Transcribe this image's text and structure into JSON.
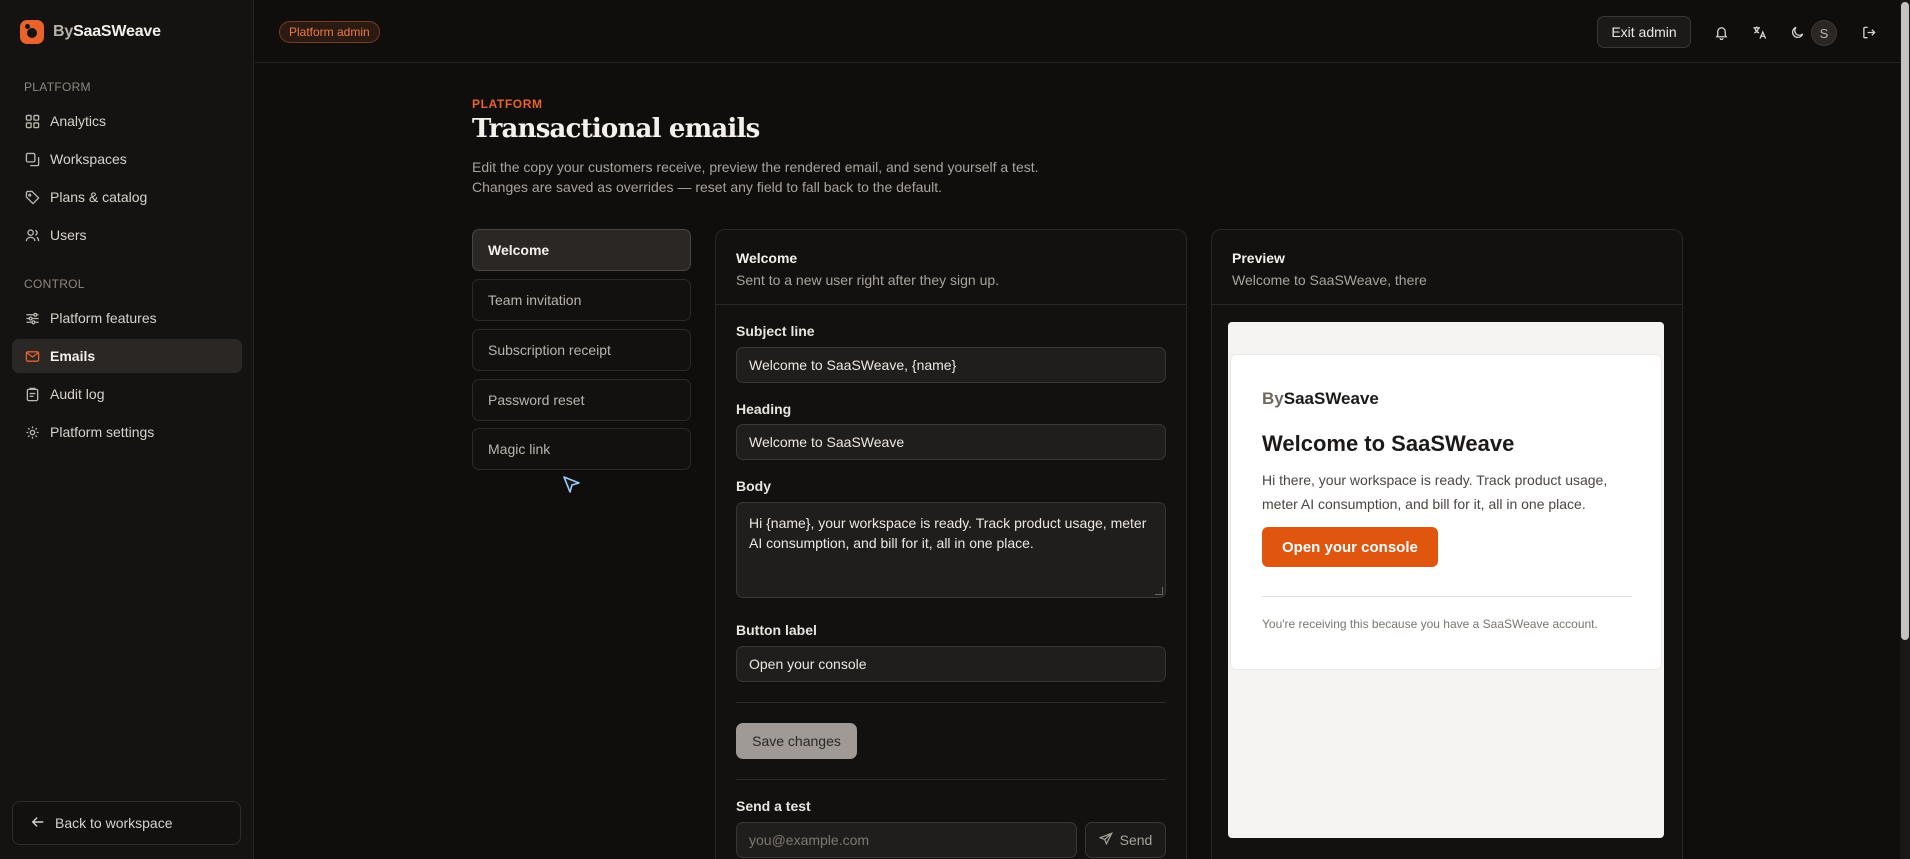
{
  "sidebar": {
    "brand_by": "By",
    "brand_name": "SaaSWeave",
    "sections": [
      {
        "label": "PLATFORM"
      },
      {
        "label": "CONTROL"
      }
    ],
    "items": [
      {
        "label": "Analytics",
        "icon": "grid-icon"
      },
      {
        "label": "Workspaces",
        "icon": "layers-icon"
      },
      {
        "label": "Plans & catalog",
        "icon": "tag-icon"
      },
      {
        "label": "Users",
        "icon": "users-icon"
      },
      {
        "label": "Platform features",
        "icon": "sliders-icon"
      },
      {
        "label": "Emails",
        "icon": "mail-icon",
        "active": true
      },
      {
        "label": "Audit log",
        "icon": "clipboard-icon"
      },
      {
        "label": "Platform settings",
        "icon": "gear-icon"
      }
    ],
    "back_label": "Back to workspace"
  },
  "topbar": {
    "badge": "Platform admin",
    "exit_label": "Exit admin",
    "avatar_initial": "S"
  },
  "page": {
    "eyebrow": "PLATFORM",
    "title": "Transactional emails",
    "desc_line1": "Edit the copy your customers receive, preview the rendered email, and send yourself a test.",
    "desc_line2": "Changes are saved as overrides — reset any field to fall back to the default."
  },
  "templates": [
    {
      "label": "Welcome",
      "active": true
    },
    {
      "label": "Team invitation"
    },
    {
      "label": "Subscription receipt"
    },
    {
      "label": "Password reset"
    },
    {
      "label": "Magic link"
    }
  ],
  "editor": {
    "title": "Welcome",
    "subtitle": "Sent to a new user right after they sign up.",
    "subject_label": "Subject line",
    "subject_value": "Welcome to SaaSWeave, {name}",
    "heading_label": "Heading",
    "heading_value": "Welcome to SaaSWeave",
    "body_label": "Body",
    "body_value": "Hi {name}, your workspace is ready. Track product usage, meter AI consumption, and bill for it, all in one place.",
    "button_label": "Button label",
    "button_value": "Open your console",
    "save_label": "Save changes",
    "test_label": "Send a test",
    "test_placeholder": "you@example.com",
    "send_label": "Send"
  },
  "preview": {
    "title": "Preview",
    "subtitle": "Welcome to SaaSWeave, there",
    "email_by": "By",
    "email_brand": "SaaSWeave",
    "email_heading": "Welcome to SaaSWeave",
    "email_body": "Hi there, your workspace is ready. Track product usage, meter AI consumption, and bill for it, all in one place.",
    "email_cta": "Open your console",
    "email_footer": "You're receiving this because you have a SaaSWeave account."
  },
  "colors": {
    "accent": "#e8622a",
    "background": "#0f0e0d",
    "sidebar": "#151312"
  }
}
